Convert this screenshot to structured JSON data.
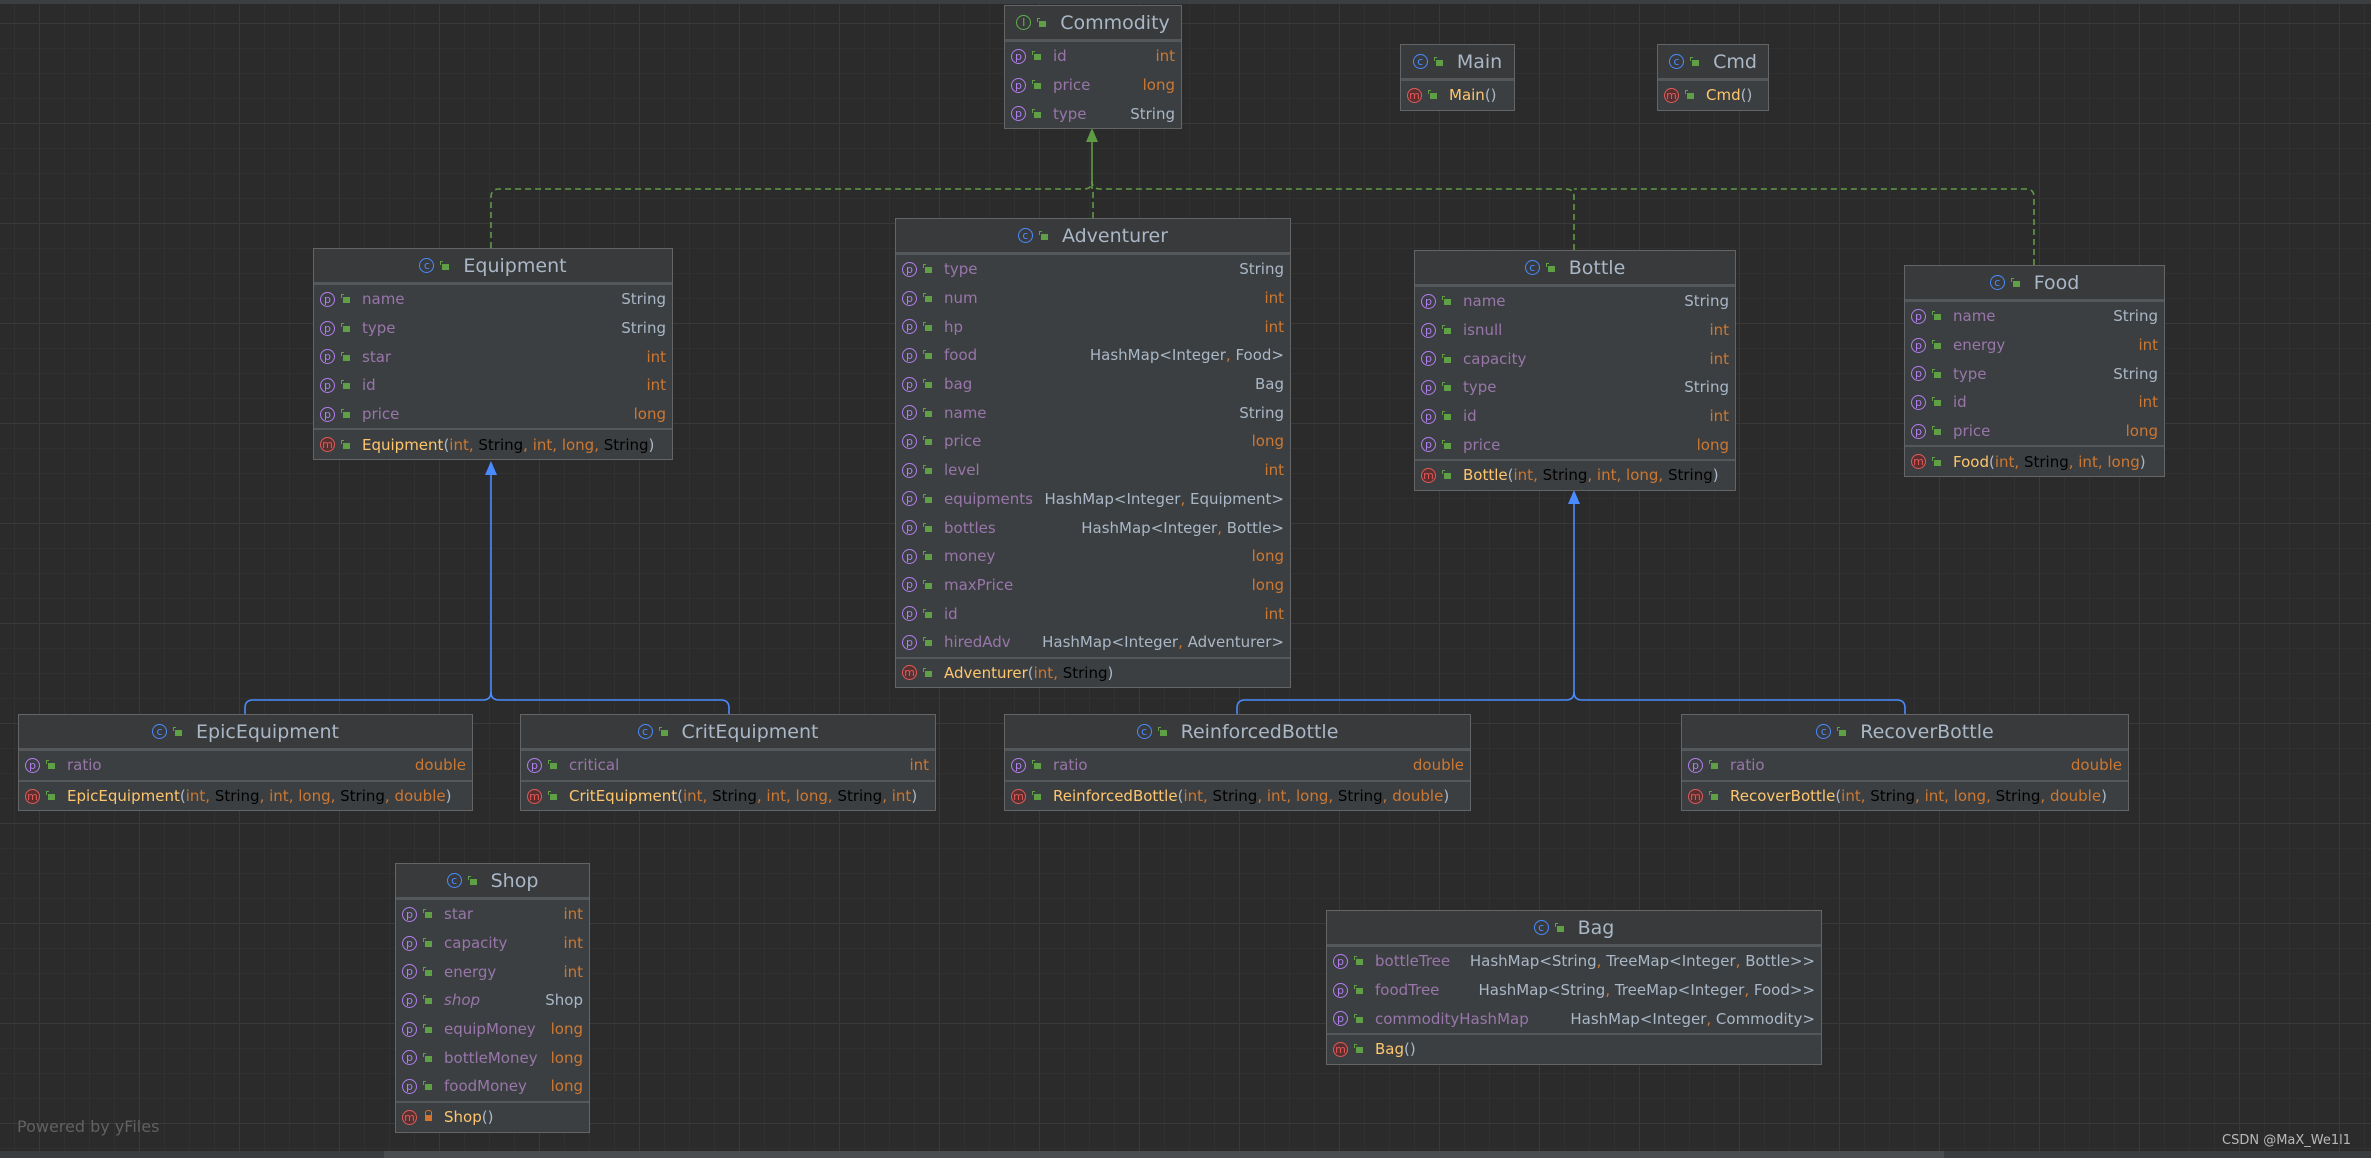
{
  "diagram": {
    "colors": {
      "background": "#2b2b2b",
      "node": "#3c3f41",
      "field_name": "#9876aa",
      "reference_type": "#a9b7c6",
      "primitive_type": "#cc7832",
      "method_name": "#ffc66d",
      "realization_edge": "#5f9a45",
      "inheritance_edge": "#4a8cff"
    },
    "classes": [
      {
        "name": "Commodity",
        "kind": "interface",
        "fields": [
          {
            "name": "id",
            "type": "int"
          },
          {
            "name": "price",
            "type": "long"
          },
          {
            "name": "type",
            "type": "String"
          }
        ],
        "methods": []
      },
      {
        "name": "Main",
        "kind": "class",
        "fields": [],
        "methods": [
          {
            "name": "Main",
            "params": [],
            "visibility": "public"
          }
        ]
      },
      {
        "name": "Cmd",
        "kind": "class",
        "fields": [],
        "methods": [
          {
            "name": "Cmd",
            "params": [],
            "visibility": "public"
          }
        ]
      },
      {
        "name": "Equipment",
        "kind": "class",
        "fields": [
          {
            "name": "name",
            "type": "String"
          },
          {
            "name": "type",
            "type": "String"
          },
          {
            "name": "star",
            "type": "int"
          },
          {
            "name": "id",
            "type": "int"
          },
          {
            "name": "price",
            "type": "long"
          }
        ],
        "methods": [
          {
            "name": "Equipment",
            "params": [
              "int",
              "String",
              "int",
              "long",
              "String"
            ],
            "visibility": "public"
          }
        ]
      },
      {
        "name": "Adventurer",
        "kind": "class",
        "fields": [
          {
            "name": "type",
            "type": "String"
          },
          {
            "name": "num",
            "type": "int"
          },
          {
            "name": "hp",
            "type": "int"
          },
          {
            "name": "food",
            "type": "HashMap<Integer, Food>"
          },
          {
            "name": "bag",
            "type": "Bag"
          },
          {
            "name": "name",
            "type": "String"
          },
          {
            "name": "price",
            "type": "long"
          },
          {
            "name": "level",
            "type": "int"
          },
          {
            "name": "equipments",
            "type": "HashMap<Integer, Equipment>"
          },
          {
            "name": "bottles",
            "type": "HashMap<Integer, Bottle>"
          },
          {
            "name": "money",
            "type": "long"
          },
          {
            "name": "maxPrice",
            "type": "long"
          },
          {
            "name": "id",
            "type": "int"
          },
          {
            "name": "hiredAdv",
            "type": "HashMap<Integer, Adventurer>"
          }
        ],
        "methods": [
          {
            "name": "Adventurer",
            "params": [
              "int",
              "String"
            ],
            "visibility": "public"
          }
        ]
      },
      {
        "name": "Bottle",
        "kind": "class",
        "fields": [
          {
            "name": "name",
            "type": "String"
          },
          {
            "name": "isnull",
            "type": "int"
          },
          {
            "name": "capacity",
            "type": "int"
          },
          {
            "name": "type",
            "type": "String"
          },
          {
            "name": "id",
            "type": "int"
          },
          {
            "name": "price",
            "type": "long"
          }
        ],
        "methods": [
          {
            "name": "Bottle",
            "params": [
              "int",
              "String",
              "int",
              "long",
              "String"
            ],
            "visibility": "public"
          }
        ]
      },
      {
        "name": "Food",
        "kind": "class",
        "fields": [
          {
            "name": "name",
            "type": "String"
          },
          {
            "name": "energy",
            "type": "int"
          },
          {
            "name": "type",
            "type": "String"
          },
          {
            "name": "id",
            "type": "int"
          },
          {
            "name": "price",
            "type": "long"
          }
        ],
        "methods": [
          {
            "name": "Food",
            "params": [
              "int",
              "String",
              "int",
              "long"
            ],
            "visibility": "public"
          }
        ]
      },
      {
        "name": "EpicEquipment",
        "kind": "class",
        "fields": [
          {
            "name": "ratio",
            "type": "double"
          }
        ],
        "methods": [
          {
            "name": "EpicEquipment",
            "params": [
              "int",
              "String",
              "int",
              "long",
              "String",
              "double"
            ],
            "visibility": "public"
          }
        ]
      },
      {
        "name": "CritEquipment",
        "kind": "class",
        "fields": [
          {
            "name": "critical",
            "type": "int"
          }
        ],
        "methods": [
          {
            "name": "CritEquipment",
            "params": [
              "int",
              "String",
              "int",
              "long",
              "String",
              "int"
            ],
            "visibility": "public"
          }
        ]
      },
      {
        "name": "ReinforcedBottle",
        "kind": "class",
        "fields": [
          {
            "name": "ratio",
            "type": "double"
          }
        ],
        "methods": [
          {
            "name": "ReinforcedBottle",
            "params": [
              "int",
              "String",
              "int",
              "long",
              "String",
              "double"
            ],
            "visibility": "public"
          }
        ]
      },
      {
        "name": "RecoverBottle",
        "kind": "class",
        "fields": [
          {
            "name": "ratio",
            "type": "double"
          }
        ],
        "methods": [
          {
            "name": "RecoverBottle",
            "params": [
              "int",
              "String",
              "int",
              "long",
              "String",
              "double"
            ],
            "visibility": "public"
          }
        ]
      },
      {
        "name": "Shop",
        "kind": "class",
        "fields": [
          {
            "name": "star",
            "type": "int"
          },
          {
            "name": "capacity",
            "type": "int"
          },
          {
            "name": "energy",
            "type": "int"
          },
          {
            "name": "shop",
            "type": "Shop",
            "static": true
          },
          {
            "name": "equipMoney",
            "type": "long"
          },
          {
            "name": "bottleMoney",
            "type": "long"
          },
          {
            "name": "foodMoney",
            "type": "long"
          }
        ],
        "methods": [
          {
            "name": "Shop",
            "params": [],
            "visibility": "private"
          }
        ]
      },
      {
        "name": "Bag",
        "kind": "class",
        "fields": [
          {
            "name": "bottleTree",
            "type": "HashMap<String, TreeMap<Integer, Bottle>>"
          },
          {
            "name": "foodTree",
            "type": "HashMap<String, TreeMap<Integer, Food>>"
          },
          {
            "name": "commodityHashMap",
            "type": "HashMap<Integer, Commodity>"
          }
        ],
        "methods": [
          {
            "name": "Bag",
            "params": [],
            "visibility": "public"
          }
        ]
      }
    ],
    "relations": [
      {
        "from": "Equipment",
        "to": "Commodity",
        "type": "implements"
      },
      {
        "from": "Adventurer",
        "to": "Commodity",
        "type": "implements"
      },
      {
        "from": "Bottle",
        "to": "Commodity",
        "type": "implements"
      },
      {
        "from": "Food",
        "to": "Commodity",
        "type": "implements"
      },
      {
        "from": "EpicEquipment",
        "to": "Equipment",
        "type": "extends"
      },
      {
        "from": "CritEquipment",
        "to": "Equipment",
        "type": "extends"
      },
      {
        "from": "ReinforcedBottle",
        "to": "Bottle",
        "type": "extends"
      },
      {
        "from": "RecoverBottle",
        "to": "Bottle",
        "type": "extends"
      }
    ]
  },
  "footer": {
    "powered_by": "Powered by yFiles",
    "watermark": "CSDN @MaX_We1l1"
  }
}
